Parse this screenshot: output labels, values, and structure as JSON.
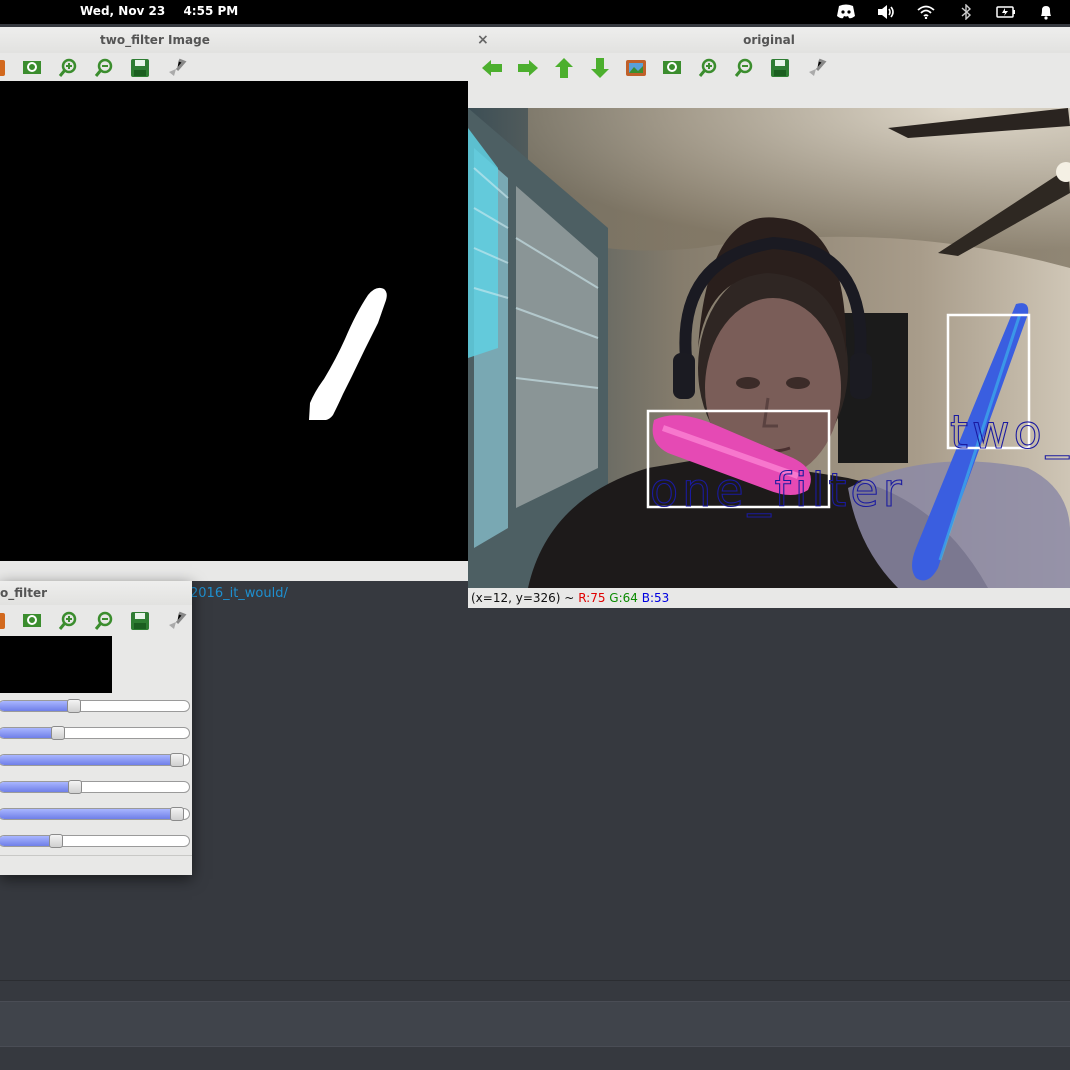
{
  "system_bar": {
    "date": "Wed, Nov 23",
    "time": "4:55 PM"
  },
  "tray_icons": [
    "discord-icon",
    "volume-icon",
    "wifi-icon",
    "bluetooth-icon",
    "battery-icon",
    "notification-bell-icon"
  ],
  "filter_window": {
    "title": "two_filter Image"
  },
  "original_window": {
    "title": "original",
    "close_label": "×",
    "labels": {
      "one": "one_filter",
      "two": "two_"
    },
    "status": {
      "coords": "(x=12, y=326) ~",
      "r": "R:75",
      "g": "G:64",
      "b": "B:53"
    }
  },
  "trackbar_window": {
    "title": "o_filter",
    "slider_levels": [
      0.38,
      0.29,
      0.96,
      0.39,
      0.96,
      0.28
    ]
  },
  "chat": {
    "link_text": "2016_it_would/"
  },
  "colors": {
    "accent_link": "#1e90d0",
    "one_filter_box": "#ffffff",
    "label_text": "#1a1aa0"
  }
}
